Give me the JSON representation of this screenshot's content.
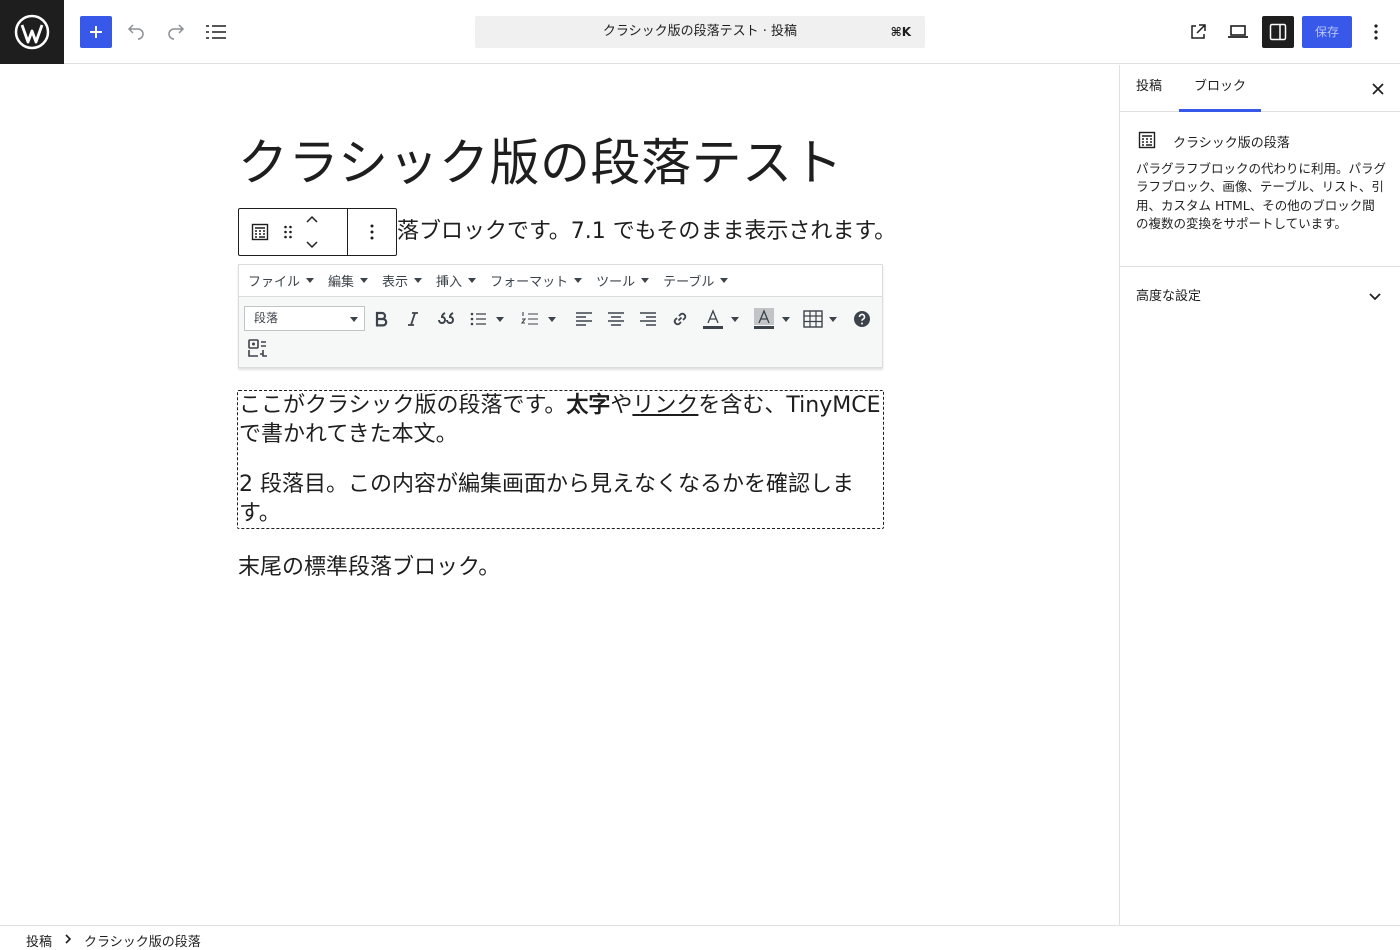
{
  "topbar": {
    "command_title": "クラシック版の段落テスト · 投稿",
    "command_shortcut": "⌘K",
    "save_label": "保存"
  },
  "editor": {
    "post_title": "クラシック版の段落テスト",
    "first_paragraph": "落ブロックです。7.1 でもそのまま表示されます。",
    "last_paragraph": "末尾の標準段落ブロック。"
  },
  "classic": {
    "menus": [
      "ファイル",
      "編集",
      "表示",
      "挿入",
      "フォーマット",
      "ツール",
      "テーブル"
    ],
    "format_select": "段落",
    "para1": {
      "before_bold": "ここがクラシック版の段落です。",
      "bold": "太字",
      "between": "や",
      "link": "リンク",
      "after": "を含む、TinyMCE で書かれてきた本文。"
    },
    "para2": "2 段落目。この内容が編集画面から見えなくなるかを確認します。"
  },
  "sidebar": {
    "tabs": [
      "投稿",
      "ブロック"
    ],
    "active_tab": "ブロック",
    "block_title": "クラシック版の段落",
    "block_description": "パラグラフブロックの代わりに利用。パラグラフブロック、画像、テーブル、リスト、引用、カスタム HTML、その他のブロック間の複数の変換をサポートしています。",
    "advanced_label": "高度な設定"
  },
  "breadcrumb": [
    "投稿",
    "クラシック版の段落"
  ],
  "colors": {
    "accent": "#3858e9",
    "dark": "#1e1e1e",
    "border": "#e0e0e0"
  }
}
